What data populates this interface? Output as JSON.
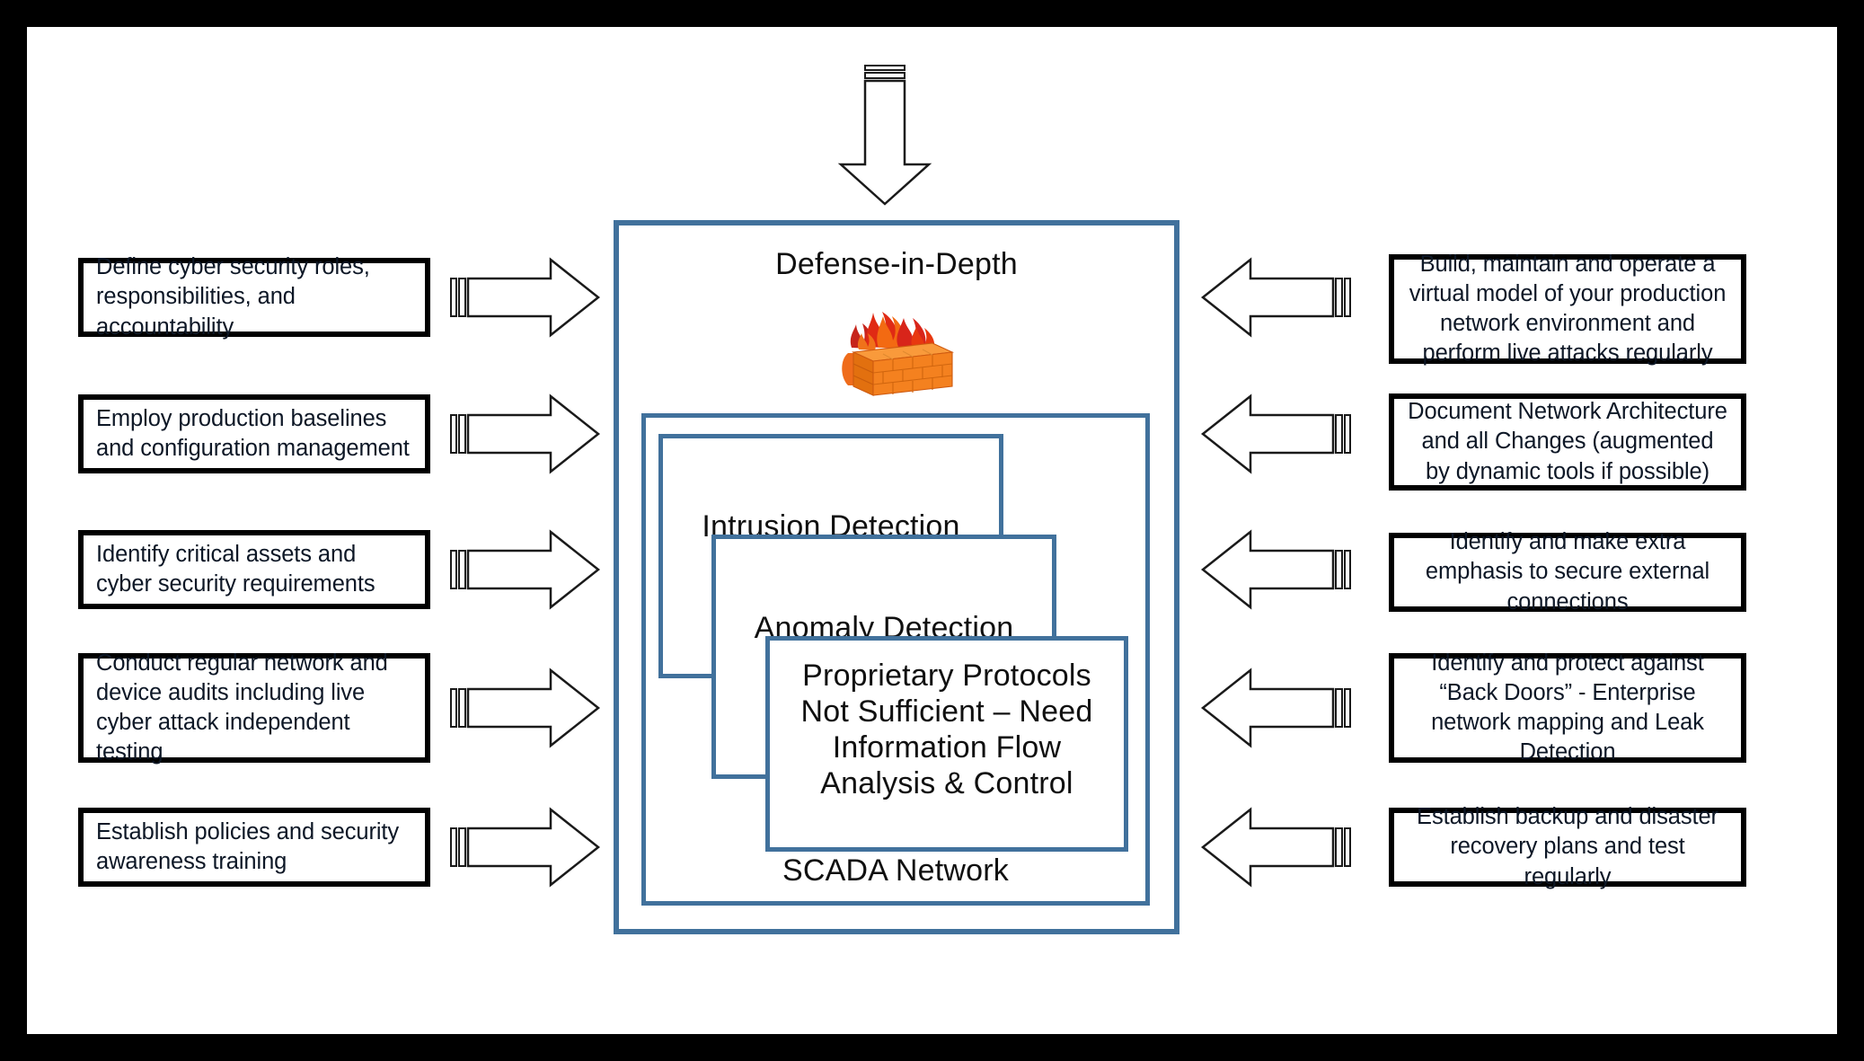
{
  "diagram": {
    "title": "Defense-in-Depth",
    "colors": {
      "frame": "#000000",
      "blue_border": "#41719c",
      "box_border": "#000000",
      "brick_orange": "#F4811F",
      "flame_red": "#D32011",
      "text": "#101010"
    },
    "top_arrow": {
      "icon": "arrow-down-striped-tail"
    },
    "center": {
      "header": "Defense-in-Depth",
      "firewall_icon": "firewall-brick-wall-flame-icon",
      "layers": [
        {
          "id": "intrusion-detection",
          "label": "Intrusion Detection"
        },
        {
          "id": "anomaly-detection",
          "label": "Anomaly Detection"
        },
        {
          "id": "proprietary-protocols",
          "label": "Proprietary Protocols\nNot Sufficient – Need\nInformation Flow\nAnalysis & Control",
          "lines": [
            "Proprietary Protocols",
            "Not Sufficient – Need",
            "Information Flow",
            "Analysis & Control"
          ]
        }
      ],
      "scada_label": "SCADA Network"
    },
    "left_column": {
      "arrow_icon": "arrow-right-striped-tail",
      "items": [
        {
          "id": "define-roles",
          "text": "Define cyber security roles, responsibilities, and accountability"
        },
        {
          "id": "production-baselines",
          "text": "Employ production baselines and configuration management"
        },
        {
          "id": "identify-critical-assets",
          "text": "Identify critical assets and cyber security requirements"
        },
        {
          "id": "conduct-audits",
          "text": "Conduct regular network and device audits including live cyber attack independent testing"
        },
        {
          "id": "establish-policies",
          "text": "Establish policies and security awareness training"
        }
      ]
    },
    "right_column": {
      "arrow_icon": "arrow-left-striped-tail",
      "items": [
        {
          "id": "virtual-model",
          "text": "Build, maintain and operate a virtual model of your production network environment and perform live attacks regularly"
        },
        {
          "id": "document-architecture",
          "text": "Document Network Architecture and all Changes (augmented by dynamic tools if possible)"
        },
        {
          "id": "external-connections",
          "text": "Identify and make extra emphasis to secure external connections"
        },
        {
          "id": "back-doors",
          "text": "Identify and protect against “Back Doors” - Enterprise network mapping and Leak Detection"
        },
        {
          "id": "backup-recovery",
          "text": "Establish backup and disaster recovery plans and test regularly"
        }
      ]
    }
  }
}
